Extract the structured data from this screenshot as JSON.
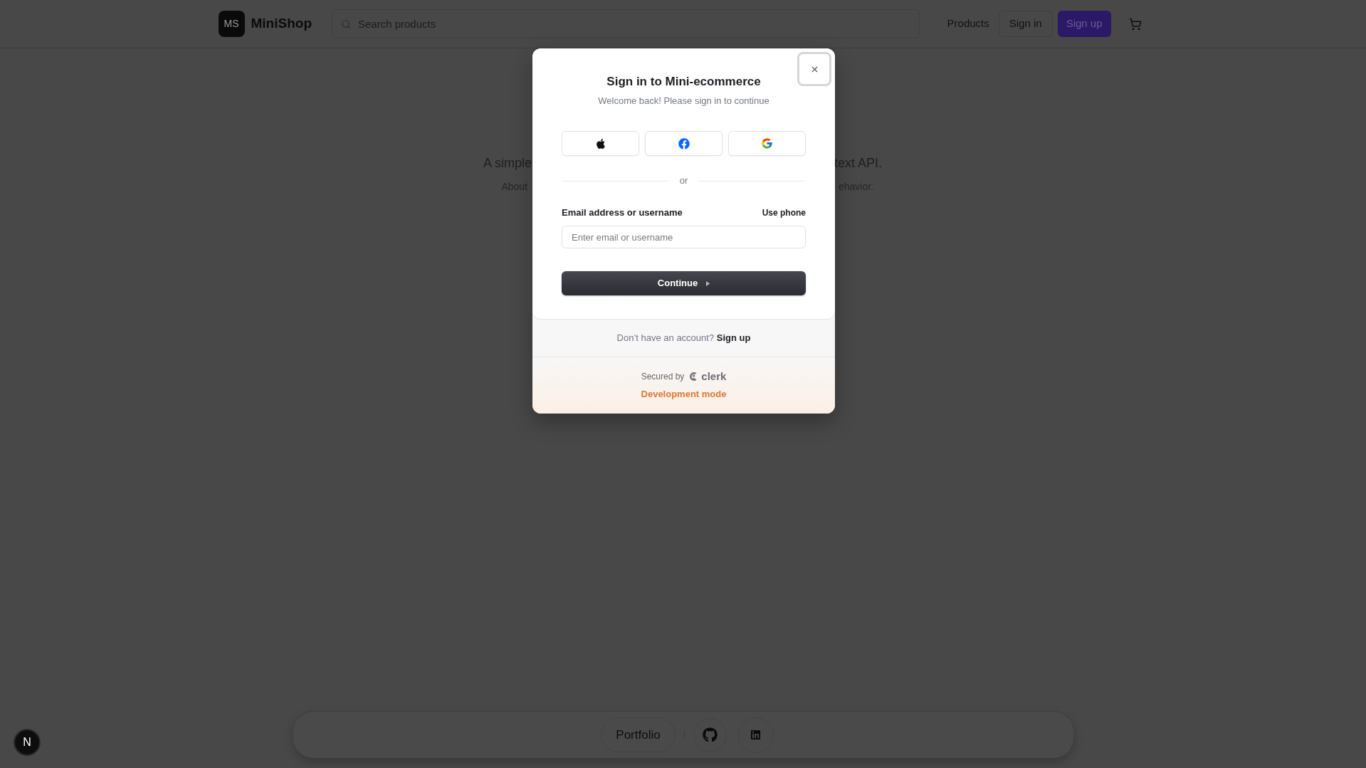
{
  "header": {
    "logo": {
      "mark": "MS",
      "name": "MiniShop"
    },
    "search": {
      "placeholder": "Search products"
    },
    "nav": [
      {
        "kind": "link",
        "label": "Products"
      },
      {
        "kind": "outline",
        "label": "Sign in"
      },
      {
        "kind": "primary",
        "label": "Sign up"
      },
      {
        "kind": "cart"
      }
    ]
  },
  "hero": {
    "lines": [
      {
        "kind": "lead",
        "left": "A simple",
        "right": "text API."
      },
      {
        "kind": "note",
        "left": "About",
        "right": "ehavior."
      }
    ]
  },
  "modal": {
    "close_button": {
      "focused": true
    },
    "title": "Sign in to Mini-ecommerce",
    "subtitle": "Welcome back! Please sign in to continue",
    "providers": [
      {
        "kind": "apple"
      },
      {
        "kind": "facebook"
      },
      {
        "kind": "google"
      }
    ],
    "divider": "or",
    "email": {
      "label": "Email address or username",
      "alt_action": "Use phone",
      "placeholder": "Enter email or username"
    },
    "submit": "Continue",
    "signup": {
      "prompt": "Don’t have an account?",
      "link": "Sign up"
    },
    "secured_by": "Secured by",
    "brand": "clerk",
    "mode": "Development mode"
  },
  "footer": {
    "links": [
      {
        "kind": "text",
        "label": "Portfolio"
      },
      {
        "kind": "github"
      },
      {
        "kind": "linkedin"
      }
    ]
  },
  "dev_indicator": {
    "label": "N"
  }
}
